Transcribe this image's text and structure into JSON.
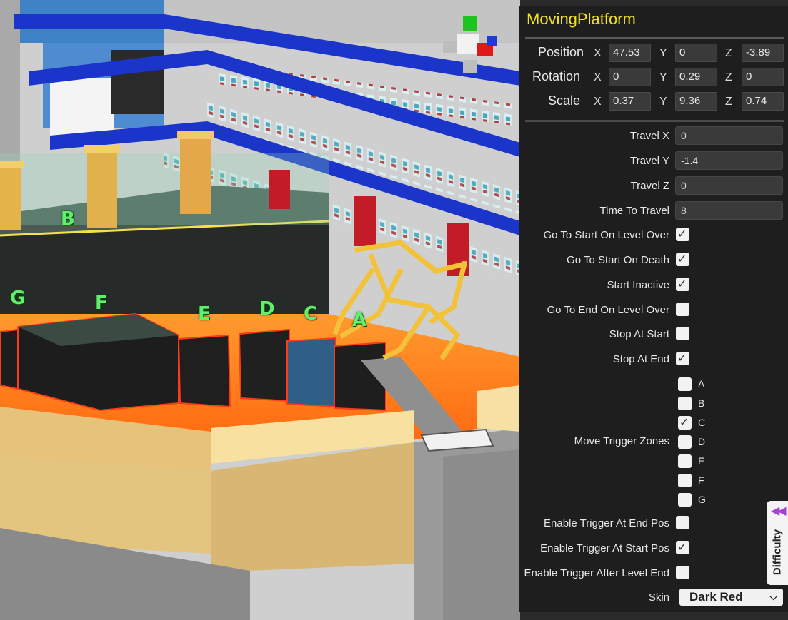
{
  "scene": {
    "zone_labels": [
      "A",
      "B",
      "C",
      "D",
      "E",
      "F",
      "G"
    ]
  },
  "inspector": {
    "title": "MovingPlatform",
    "transform": {
      "position": {
        "label": "Position",
        "x": "47.53",
        "y": "0",
        "z": "-3.89"
      },
      "rotation": {
        "label": "Rotation",
        "x": "0",
        "y": "0.29",
        "z": "0"
      },
      "scale": {
        "label": "Scale",
        "x": "0.37",
        "y": "9.36",
        "z": "0.74"
      },
      "axis_x": "X",
      "axis_y": "Y",
      "axis_z": "Z"
    },
    "fields": {
      "travel_x": {
        "label": "Travel X",
        "value": "0"
      },
      "travel_y": {
        "label": "Travel Y",
        "value": "-1.4"
      },
      "travel_z": {
        "label": "Travel Z",
        "value": "0"
      },
      "time_to_travel": {
        "label": "Time To Travel",
        "value": "8"
      }
    },
    "toggles": [
      {
        "label": "Go To Start On Level Over",
        "checked": true
      },
      {
        "label": "Go To Start On Death",
        "checked": true
      },
      {
        "label": "Start Inactive",
        "checked": true
      },
      {
        "label": "Go To End On Level Over",
        "checked": false
      },
      {
        "label": "Stop At Start",
        "checked": false
      },
      {
        "label": "Stop At End",
        "checked": true
      }
    ],
    "move_trigger_zones": {
      "label": "Move Trigger Zones",
      "zones": [
        {
          "name": "A",
          "checked": false
        },
        {
          "name": "B",
          "checked": false
        },
        {
          "name": "C",
          "checked": true
        },
        {
          "name": "D",
          "checked": false
        },
        {
          "name": "E",
          "checked": false
        },
        {
          "name": "F",
          "checked": false
        },
        {
          "name": "G",
          "checked": false
        }
      ]
    },
    "toggles_2": [
      {
        "label": "Enable Trigger At End Pos",
        "checked": false
      },
      {
        "label": "Enable Trigger At Start Pos",
        "checked": true
      },
      {
        "label": "Enable Trigger After Level End",
        "checked": false
      }
    ],
    "skin": {
      "label": "Skin",
      "value": "Dark Red"
    }
  },
  "difficulty_tab": {
    "label": "Difficulty",
    "icon": "double-chevron-left-icon",
    "accent": "#a53fd6"
  },
  "colors": {
    "title": "#f2e31b",
    "panel": "#1e1e1e",
    "lava": "#ff7a1a",
    "zone_label": "#5ff06a"
  }
}
